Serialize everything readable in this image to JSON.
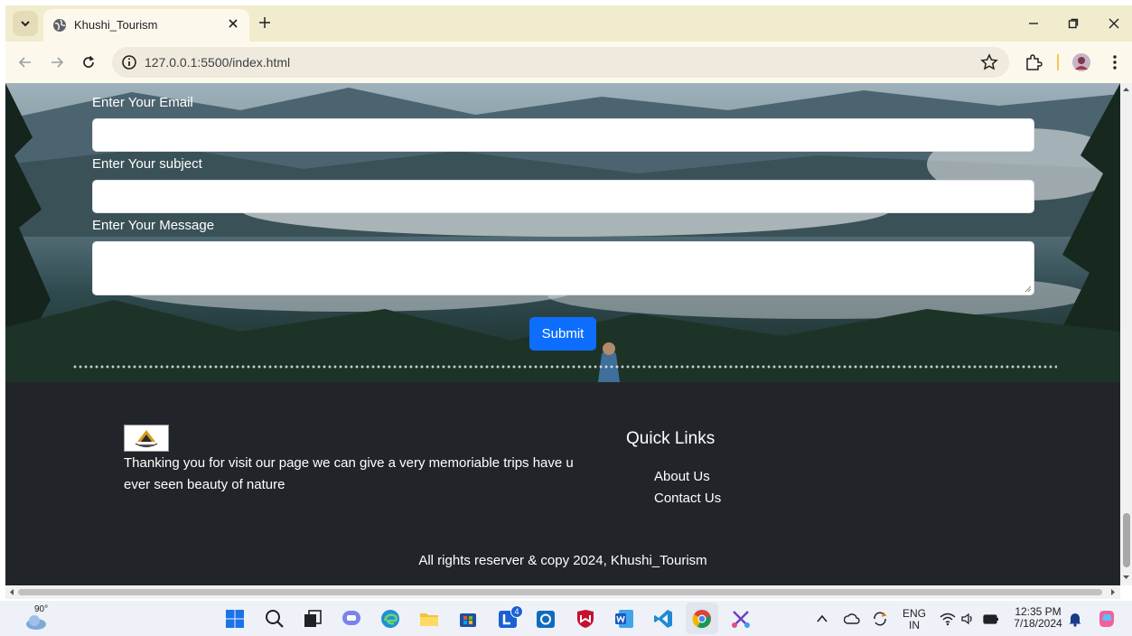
{
  "browser": {
    "tab_title": "Khushi_Tourism",
    "url": "127.0.0.1:5500/index.html"
  },
  "form": {
    "email_label": "Enter Your Email",
    "subject_label": "Enter Your subject",
    "message_label": "Enter Your Message",
    "submit_label": "Submit"
  },
  "footer": {
    "about_text": "Thanking you for visit our page we can give a very memoriable trips have u ever seen beauty of nature",
    "quick_links_title": "Quick Links",
    "links": [
      "About Us",
      "Contact Us"
    ],
    "copyright": "All rights reserver & copy 2024, Khushi_Tourism"
  },
  "taskbar": {
    "weather_temp": "90°",
    "lang_line1": "ENG",
    "lang_line2": "IN",
    "time": "12:35 PM",
    "date": "7/18/2024",
    "badge_count": "4"
  },
  "colors": {
    "submit": "#0d6efd",
    "footer_bg": "#212529",
    "tabstrip_bg": "#f1eccd"
  }
}
